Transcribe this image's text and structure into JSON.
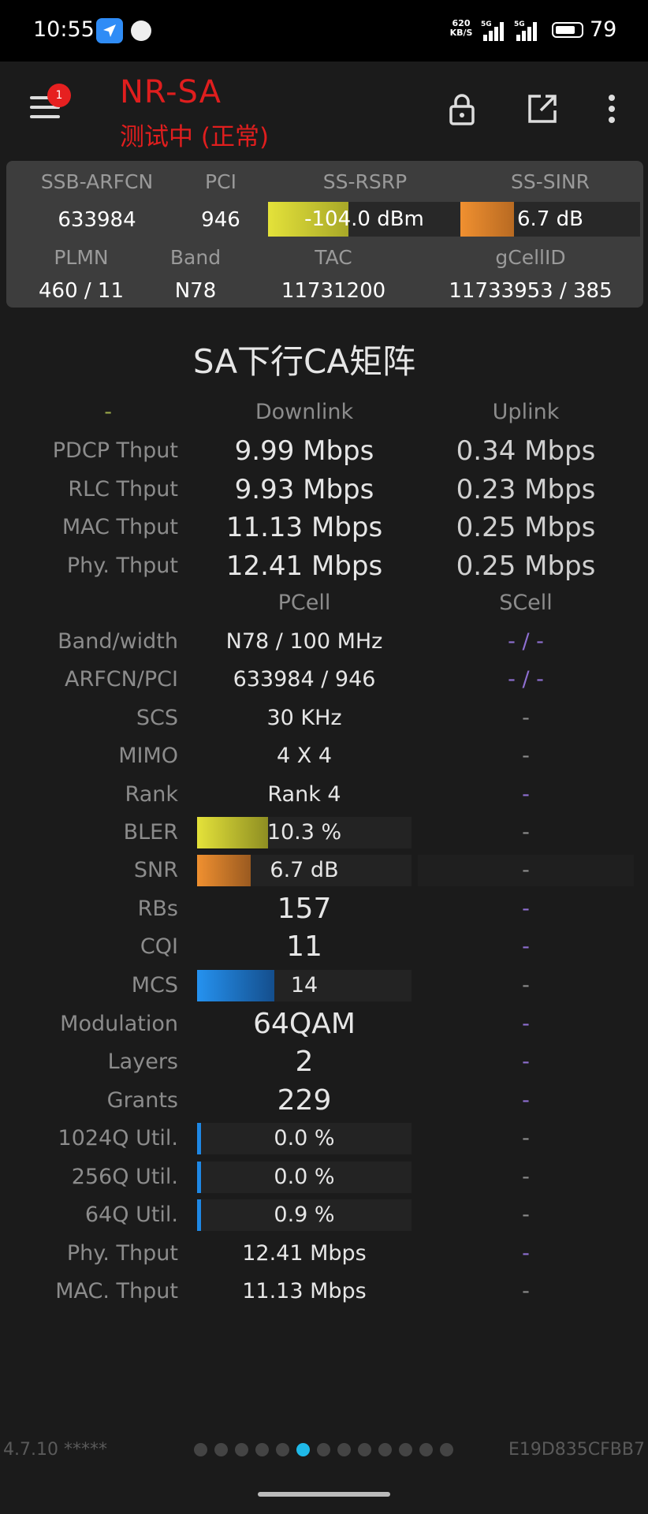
{
  "status_bar": {
    "time": "10:55",
    "speed_value": "620",
    "speed_unit": "KB/S",
    "sig1": "5G",
    "sig2": "5G",
    "battery": "79",
    "battery_level": 0.79
  },
  "app_bar": {
    "badge": "1",
    "title": "NR-SA",
    "subtitle": "测试中 (正常)"
  },
  "info_panel": {
    "headers1": [
      "SSB-ARFCN",
      "PCI",
      "SS-RSRP",
      "SS-SINR"
    ],
    "values1": {
      "arfcn": "633984",
      "pci": "946",
      "rsrp": "-104.0 dBm",
      "sinr": "6.7 dB"
    },
    "rsrp_fill": 0.42,
    "sinr_fill": 0.3,
    "headers2": [
      "PLMN",
      "Band",
      "TAC",
      "gCellID"
    ],
    "values2": [
      "460 / 11",
      "N78",
      "11731200",
      "11733953 / 385"
    ]
  },
  "matrix": {
    "title": "SA下行CA矩阵",
    "header": {
      "label": "-",
      "downlink": "Downlink",
      "uplink": "Uplink"
    },
    "throughput": [
      {
        "label": "PDCP Thput",
        "dl": "9.99 Mbps",
        "ul": "0.34 Mbps"
      },
      {
        "label": "RLC Thput",
        "dl": "9.93 Mbps",
        "ul": "0.23 Mbps"
      },
      {
        "label": "MAC Thput",
        "dl": "11.13 Mbps",
        "ul": "0.25 Mbps"
      },
      {
        "label": "Phy. Thput",
        "dl": "12.41 Mbps",
        "ul": "0.25 Mbps"
      }
    ],
    "cell_header": {
      "pcell": "PCell",
      "scell": "SCell"
    },
    "band_width": {
      "label": "Band/width",
      "pcell": "N78 / 100 MHz",
      "scell": "- / -"
    },
    "arfcn_pci": {
      "label": "ARFCN/PCI",
      "pcell": "633984 / 946",
      "scell": "- / -"
    },
    "scs": {
      "label": "SCS",
      "pcell": "30 KHz",
      "scell": "-"
    },
    "mimo": {
      "label": "MIMO",
      "pcell": "4 X 4",
      "scell": "-"
    },
    "rank": {
      "label": "Rank",
      "pcell": "Rank 4",
      "scell": "-"
    },
    "bler": {
      "label": "BLER",
      "pcell": "10.3 %",
      "fill": 0.33,
      "scell": "-"
    },
    "snr": {
      "label": "SNR",
      "pcell": "6.7 dB",
      "fill": 0.25,
      "scell": "-"
    },
    "rbs": {
      "label": "RBs",
      "pcell": "157",
      "scell": "-"
    },
    "cqi": {
      "label": "CQI",
      "pcell": "11",
      "scell": "-"
    },
    "mcs": {
      "label": "MCS",
      "pcell": "14",
      "fill": 0.36,
      "scell": "-"
    },
    "modulation": {
      "label": "Modulation",
      "pcell": "64QAM",
      "scell": "-"
    },
    "layers": {
      "label": "Layers",
      "pcell": "2",
      "scell": "-"
    },
    "grants": {
      "label": "Grants",
      "pcell": "229",
      "scell": "-"
    },
    "util_1024": {
      "label": "1024Q Util.",
      "pcell": "0.0 %",
      "scell": "-"
    },
    "util_256": {
      "label": "256Q Util.",
      "pcell": "0.0 %",
      "scell": "-"
    },
    "util_64": {
      "label": "64Q Util.",
      "pcell": "0.9 %",
      "scell": "-"
    },
    "phy_thput": {
      "label": "Phy. Thput",
      "pcell": "12.41 Mbps",
      "scell": "-"
    },
    "mac_thput": {
      "label": "MAC. Thput",
      "pcell": "11.13 Mbps",
      "scell": "-"
    }
  },
  "footer": {
    "version": "4.7.10 *****",
    "device_id": "E19D835CFBB7",
    "page_count": 13,
    "active_page": 5
  },
  "colors": {
    "title_red": "#e01e1e",
    "rsrp_yellow": "#d7d62a",
    "sinr_orange": "#e8872a",
    "mcs_blue": "#1e88e5",
    "dot_active": "#1fb9e8",
    "dash_purple": "#8e6fd1"
  }
}
